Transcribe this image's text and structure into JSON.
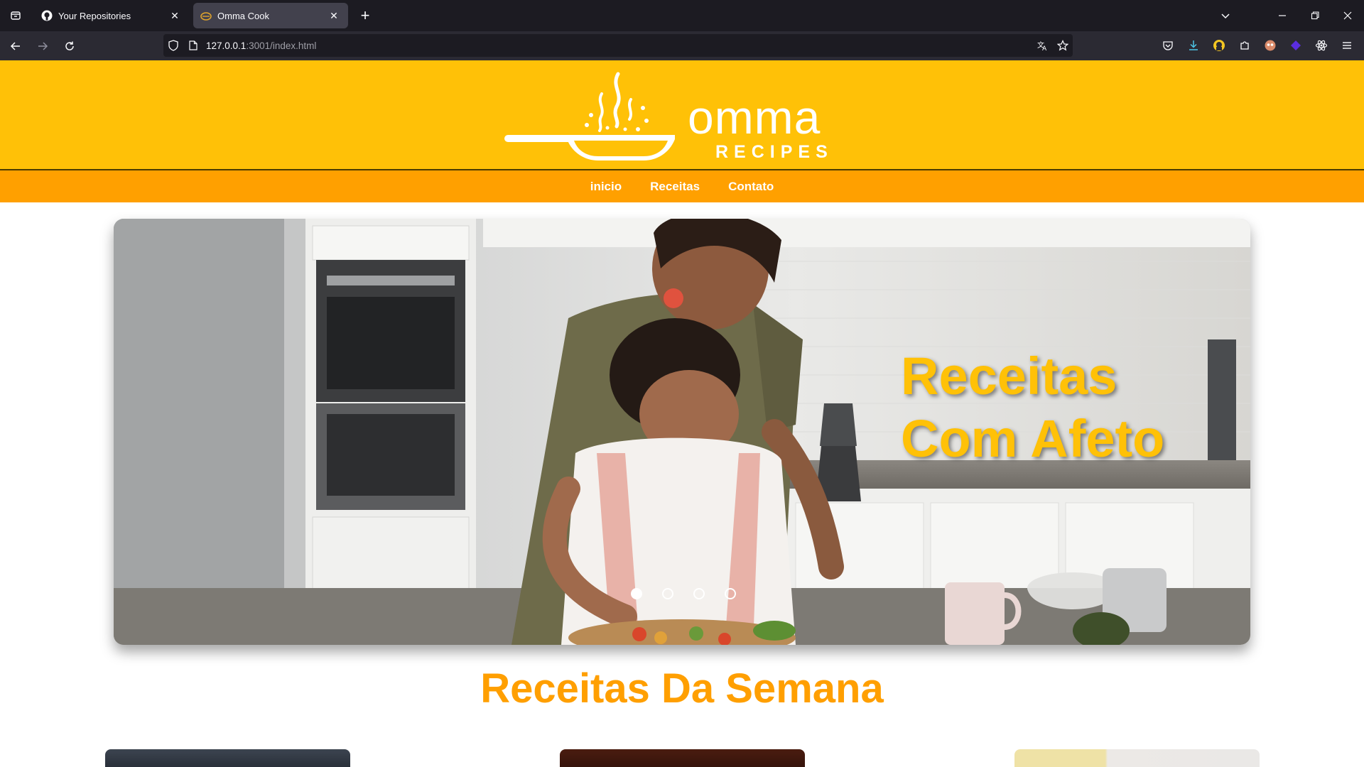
{
  "browser": {
    "tabs": [
      {
        "title": "Your Repositories",
        "icon": "github-icon",
        "active": false
      },
      {
        "title": "Omma Cook",
        "icon": "omma-cook-favicon",
        "active": true
      }
    ],
    "url_host": "127.0.0.1",
    "url_rest": ":3001/index.html"
  },
  "site": {
    "logo_word": "omma",
    "logo_sub": "RECIPES",
    "nav": [
      "inicio",
      "Receitas",
      "Contato"
    ]
  },
  "hero": {
    "title_line1": "Receitas",
    "title_line2": "Com Afeto",
    "slides": 4,
    "active_slide": 1
  },
  "section": {
    "title": "Receitas Da Semana"
  },
  "colors": {
    "header_yellow": "#ffc107",
    "nav_orange": "#ffa000",
    "title_orange": "#ff9f00",
    "chrome_dark": "#1c1b22"
  }
}
